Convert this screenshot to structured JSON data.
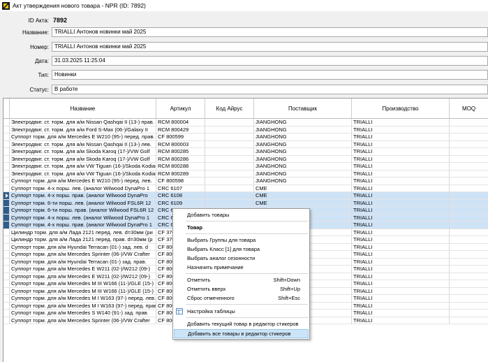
{
  "window": {
    "title": "Акт утверждения нового товара - NPR (ID: 7892)"
  },
  "form": {
    "id_label": "ID Акта:",
    "id_value": "7892",
    "name_label": "Название:",
    "name_value": "TRIALLI Антонов новинки май 2025",
    "number_label": "Номер:",
    "number_value": "TRIALLI Антонов новинки май 2025",
    "date_label": "Дата:",
    "date_value": "31.03.2025 11:25:04",
    "type_label": "Тип:",
    "type_value": "Новинки",
    "status_label": "Статус:",
    "status_value": "В работе"
  },
  "grid": {
    "columns": [
      "Название",
      "Артикул",
      "Код Айрус",
      "Поставщик",
      "Производство",
      "MOQ"
    ],
    "rows": [
      [
        "Электродвиг. ст. торм. для а/м Nissan Qashqai II (13-) прав.",
        "RCM 800004",
        "",
        "JIANGHONG",
        "TRIALLI",
        ""
      ],
      [
        "Электродвиг. ст. торм. для а/м Ford S-Max (06-)/Galaxy II",
        "RCM 800429",
        "",
        "JIANGHONG",
        "TRIALLI",
        ""
      ],
      [
        "Суппорт торм. для а/м Mercedes E W210 (95-) перед. прав.",
        "CF 800599",
        "",
        "JIANGHONG",
        "TRIALLI",
        ""
      ],
      [
        "Электродвиг. ст. торм. для а/м Nissan Qashqai II (13-) лев.",
        "RCM 800003",
        "",
        "JIANGHONG",
        "TRIALLI",
        ""
      ],
      [
        "Электродвиг. ст. торм. для а/м Skoda Karoq (17-)/VW Golf",
        "RCM 800285",
        "",
        "JIANGHONG",
        "TRIALLI",
        ""
      ],
      [
        "Электродвиг. ст. торм. для а/м Skoda Karoq (17-)/VW Golf",
        "RCM 800286",
        "",
        "JIANGHONG",
        "TRIALLI",
        ""
      ],
      [
        "Электродвиг. ст. торм. для а/м VW Tiguan (16-)/Skoda Kodiaq",
        "RCM 800288",
        "",
        "JIANGHONG",
        "TRIALLI",
        ""
      ],
      [
        "Электродвиг. ст. торм. для а/м VW Tiguan (16-)/Skoda Kodiaq",
        "RCM 800289",
        "",
        "JIANGHONG",
        "TRIALLI",
        ""
      ],
      [
        "Суппорт торм. для а/м Mercedes E W210 (95-) перед. лев.",
        "CF 800598",
        "",
        "JIANGHONG",
        "TRIALLI",
        ""
      ],
      [
        "Суппорт торм. 4-х порш. лев. (аналог Wilwood DynaPro 1",
        "CRC 6107",
        "",
        "CME",
        "TRIALLI",
        ""
      ],
      [
        "Суппорт торм. 4-х порш. прав. (аналог Wilwood DynaPro",
        "CRC 6108",
        "",
        "CME",
        "TRIALLI",
        ""
      ],
      [
        "Суппорт торм. 6-ти порш. лев. (аналог Wilwood FSL6R 12",
        "CRC 6109",
        "",
        "CME",
        "TRIALLI",
        ""
      ],
      [
        "Суппорт торм. 6-ти порш. прав. (аналог Wilwood FSL6R 12",
        "CRC 6110",
        "",
        "CME",
        "TRIALLI",
        ""
      ],
      [
        "Суппорт торм. 4-х порш. лев. (аналог Wilwood DynaPro 1",
        "CRC 6111",
        "",
        "CME",
        "TRIALLI",
        ""
      ],
      [
        "Суппорт торм. 4-х порш. прав. (аналог Wilwood DynaPro 1",
        "CRC 6112",
        "",
        "CME",
        "TRIALLI",
        ""
      ],
      [
        "Цилиндр торм. для а/м Лада 2121 перед. лев. d=30мм (ри",
        "CF 3701",
        "",
        "JIANGHONG",
        "TRIALLI",
        ""
      ],
      [
        "Цилиндр торм. для а/м Лада 2121 перед. прав. d=30мм (р",
        "CF 3702",
        "",
        "JIANGHONG",
        "TRIALLI",
        ""
      ],
      [
        "Суппорт торм. для а/м Hyundai Terracan (01-) зад. лев. d",
        "CF 800601",
        "",
        "JIANGHONG",
        "TRIALLI",
        ""
      ],
      [
        "Суппорт торм. для а/м Mercedes Sprinter (06-)/VW Crafter",
        "CF 800602",
        "",
        "JIANGHONG",
        "TRIALLI",
        ""
      ],
      [
        "Суппорт торм. для а/м Hyundai Terracan (01-) зад. прав.",
        "CF 800603",
        "",
        "JIANGHONG",
        "TRIALLI",
        ""
      ],
      [
        "Суппорт торм. для а/м Mercedes E W211 (02-)/W212 (09-)",
        "CF 800604",
        "",
        "JIANGHONG",
        "TRIALLI",
        ""
      ],
      [
        "Суппорт торм. для а/м Mercedes E W211 (02-)/W212 (09-)",
        "CF 800605",
        "",
        "JIANGHONG",
        "TRIALLI",
        ""
      ],
      [
        "Суппорт торм. для а/м Mercedes M III W166 (11-)/GLE (15-)",
        "CF 800606",
        "",
        "JIANGHONG",
        "TRIALLI",
        ""
      ],
      [
        "Суппорт торм. для а/м Mercedes M III W166 (11-)/GLE (15-)",
        "CF 800607",
        "",
        "JIANGHONG",
        "TRIALLI",
        ""
      ],
      [
        "Суппорт торм. для а/м Mercedes M I W163 (97-) перед. лев.",
        "CF 800548",
        "",
        "JIANGHONG",
        "TRIALLI",
        ""
      ],
      [
        "Суппорт торм. для а/м Mercedes M I W163 (97-) перед. прав.",
        "CF 800551",
        "",
        "JIANGHONG",
        "TRIALLI",
        ""
      ],
      [
        "Суппорт торм. для а/м Mercedes S W140 (91-) зад. прав.",
        "CF 800590",
        "",
        "JIANGHONG",
        "TRIALLI",
        ""
      ],
      [
        "Суппорт торм. для а/м Mercedes Sprinter (06-)/VW Crafter",
        "CF 800566",
        "",
        "JIANGHONG",
        "TRIALLI",
        ""
      ]
    ]
  },
  "context_menu": {
    "add_items": "Добавить товары",
    "product_header": "Товар",
    "select_groups": "Выбрать Группы для товара",
    "select_class": "Выбрать Класс [1] для товара",
    "select_season": "Выбрать аналог сезонности",
    "set_note": "Назначить примечание",
    "mark": "Отметить",
    "mark_sc": "Shift+Down",
    "mark_up": "Отметить вверх",
    "mark_up_sc": "Shift+Up",
    "reset_marked": "Сброс отмеченного",
    "reset_marked_sc": "Shift+Esc",
    "table_settings": "Настройка таблицы",
    "add_current_sticker": "Добавить текущий товар в редактор стикеров",
    "add_all_sticker": "Добавить все товары в редактор стикеров"
  }
}
